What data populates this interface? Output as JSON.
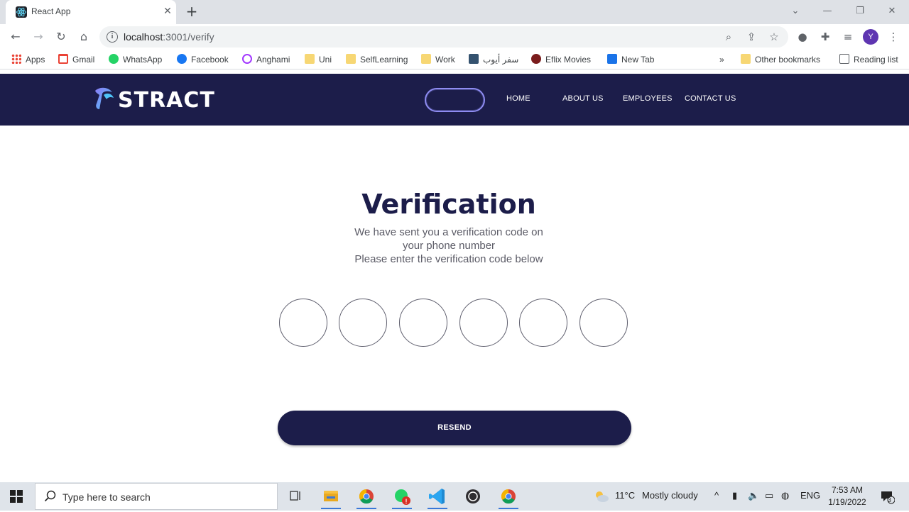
{
  "browser": {
    "tab_title": "React App",
    "url_host": "localhost",
    "url_path": ":3001/verify",
    "avatar_letter": "Y",
    "bookmarks": [
      "Apps",
      "Gmail",
      "WhatsApp",
      "Facebook",
      "Anghami",
      "Uni",
      "SelfLearning",
      "Work",
      "سفر أيوب",
      "Eflix Movies",
      "New Tab"
    ],
    "overflow": "»",
    "other_bookmarks": "Other bookmarks",
    "reading_list": "Reading list"
  },
  "header": {
    "logo": "STRACT",
    "nav": [
      "HOME",
      "ABOUT US",
      "EMPLOYEES",
      "CONTACT US"
    ]
  },
  "main": {
    "title": "Verification",
    "line1": "We have sent you a verification code on",
    "line2": "your phone number",
    "line3": "Please enter the verification code below",
    "code_digits": [
      "",
      "",
      "",
      "",
      "",
      ""
    ],
    "resend_label": "RESEND"
  },
  "taskbar": {
    "search_placeholder": "Type here to search",
    "weather_temp": "11°C",
    "weather_desc": "Mostly cloudy",
    "language": "ENG",
    "time": "7:53 AM",
    "date": "1/19/2022",
    "notification_count": "3"
  },
  "colors": {
    "brand_navy": "#1c1d4a",
    "accent_purple": "#8f8cf2"
  }
}
